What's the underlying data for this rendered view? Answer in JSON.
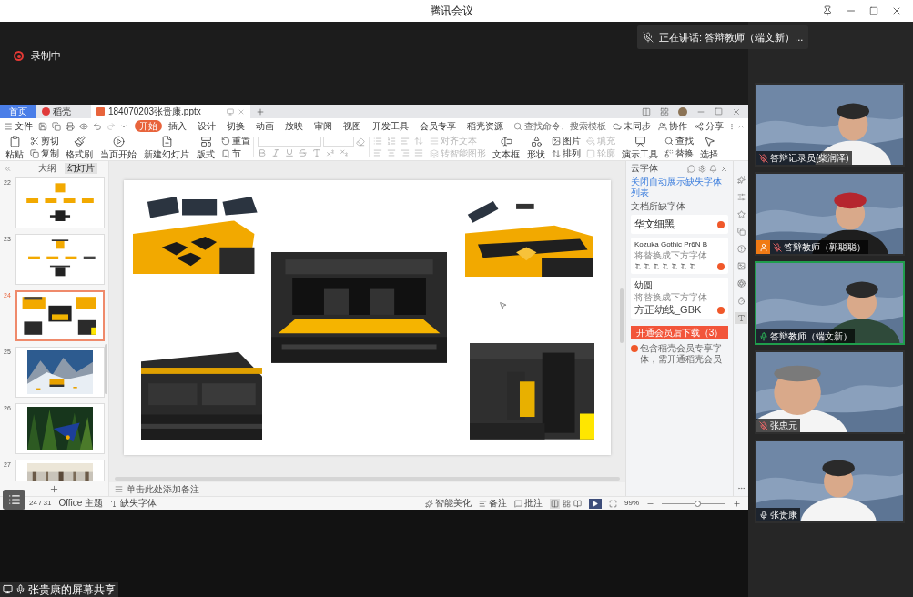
{
  "window": {
    "title": "腾讯会议"
  },
  "recording": {
    "label": "录制中"
  },
  "speaking_banner": {
    "text": "正在讲话: 答辩教师（端文新）..."
  },
  "shared_screen": {
    "app_tabs": [
      {
        "label": "首页",
        "kind": "home"
      },
      {
        "label": "稻壳",
        "kind": "store"
      },
      {
        "label": "184070203张贵康.pptx",
        "kind": "file"
      }
    ],
    "menu": {
      "file": "文件",
      "tabs": [
        {
          "label": "开始",
          "selected": true
        },
        {
          "label": "插入",
          "selected": false
        },
        {
          "label": "设计",
          "selected": false
        },
        {
          "label": "切换",
          "selected": false
        },
        {
          "label": "动画",
          "selected": false
        },
        {
          "label": "放映",
          "selected": false
        },
        {
          "label": "审阅",
          "selected": false
        },
        {
          "label": "视图",
          "selected": false
        },
        {
          "label": "开发工具",
          "selected": false
        },
        {
          "label": "会员专享",
          "selected": false
        },
        {
          "label": "稻壳资源",
          "selected": false
        }
      ],
      "search_placeholder": "查找命令、搜索模板",
      "actions": [
        "未同步",
        "协作",
        "分享"
      ]
    },
    "ribbon": [
      {
        "kind": "large",
        "label": "粘贴"
      },
      {
        "kind": "stack",
        "items": [
          {
            "label": "剪切",
            "disabled": false
          },
          {
            "label": "复制",
            "disabled": false
          }
        ]
      },
      {
        "kind": "large",
        "label": "格式刷"
      },
      {
        "kind": "large",
        "label": "当页开始"
      },
      {
        "kind": "large",
        "label": "新建幻灯片"
      },
      {
        "kind": "large",
        "label": "版式"
      },
      {
        "kind": "stack",
        "items": [
          {
            "label": "重置",
            "disabled": false
          },
          {
            "label": "节",
            "disabled": false
          }
        ]
      },
      {
        "kind": "font"
      },
      {
        "kind": "paragraph"
      },
      {
        "kind": "stack",
        "items": [
          {
            "label": "对齐文本",
            "disabled": true
          },
          {
            "label": "转智能图形",
            "disabled": true
          }
        ]
      },
      {
        "kind": "large",
        "label": "文本框"
      },
      {
        "kind": "large",
        "label": "形状"
      },
      {
        "kind": "stack",
        "items": [
          {
            "label": "图片",
            "disabled": false
          },
          {
            "label": "排列",
            "disabled": false
          }
        ]
      },
      {
        "kind": "stack",
        "items": [
          {
            "label": "填充",
            "disabled": true
          },
          {
            "label": "轮廓",
            "disabled": true
          }
        ]
      },
      {
        "kind": "large",
        "label": "演示工具"
      },
      {
        "kind": "stack",
        "items": [
          {
            "label": "查找",
            "disabled": false
          },
          {
            "label": "替换",
            "disabled": false
          }
        ]
      },
      {
        "kind": "large",
        "label": "选择"
      }
    ],
    "panel_tabs": [
      {
        "label": "大纲",
        "selected": false
      },
      {
        "label": "幻灯片",
        "selected": true
      }
    ],
    "slides": [
      {
        "number": "22",
        "selected": false
      },
      {
        "number": "23",
        "selected": false
      },
      {
        "number": "24",
        "selected": true
      },
      {
        "number": "25",
        "selected": false
      },
      {
        "number": "26",
        "selected": false
      },
      {
        "number": "27",
        "selected": false
      }
    ],
    "notes_placeholder": "单击此处添加备注",
    "font_panel": {
      "title": "云字体",
      "link": "关闭自动展示缺失字体列表",
      "section": "文档所缺字体",
      "fonts": [
        {
          "kind": "plain",
          "name": "华文细黑"
        },
        {
          "kind": "sample",
          "name": "Kozuka Gothic Pr6N B",
          "hint": "将替换成下方字体"
        },
        {
          "kind": "replacement",
          "name": "幼圆",
          "hint": "将替换成下方字体",
          "replacement": "方正幼线_GBK"
        }
      ],
      "button": "开通会员后下载（3）",
      "note": "包含稻壳会员专享字体，需开通稻壳会员"
    },
    "side_tools": [
      {
        "selected": false
      },
      {
        "selected": false
      },
      {
        "selected": false
      },
      {
        "selected": false
      },
      {
        "selected": false
      },
      {
        "selected": false
      },
      {
        "selected": false
      },
      {
        "selected": false
      },
      {
        "selected": true
      }
    ],
    "status_bar": {
      "slide_count": "24 / 31",
      "theme": "Office 主题",
      "missing_fonts": "缺失字体",
      "beautify": "智能美化",
      "notes": "备注",
      "comments": "批注",
      "zoom": "99%",
      "zoom_slider": {
        "level": 0.55
      }
    }
  },
  "share_label": "张贵康的屏幕共享",
  "participants": [
    {
      "name": "答辩记录员(柴润泽)",
      "muted": true,
      "speaking": false,
      "badge": false
    },
    {
      "name": "答辩教师（郭聪聪）",
      "muted": true,
      "speaking": false,
      "badge": true
    },
    {
      "name": "答辩教师（端文新）",
      "muted": false,
      "speaking": true,
      "badge": false
    },
    {
      "name": "张忠元",
      "muted": true,
      "speaking": false,
      "badge": false
    },
    {
      "name": "张贵康",
      "muted": false,
      "speaking": false,
      "badge": false
    }
  ]
}
